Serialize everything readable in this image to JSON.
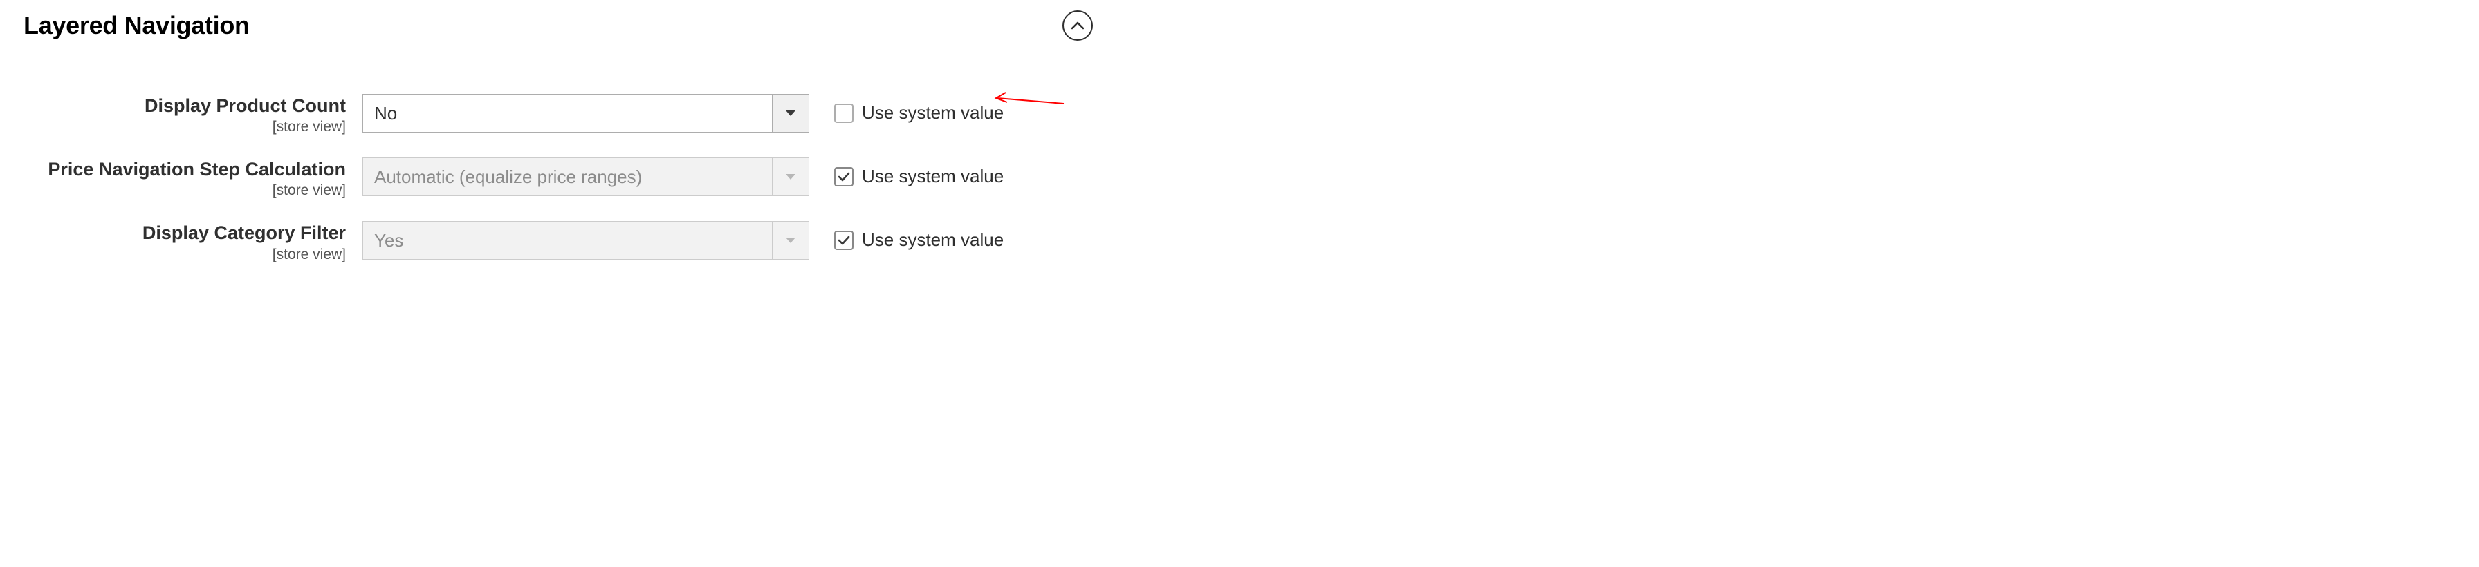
{
  "section": {
    "title": "Layered Navigation"
  },
  "fields": [
    {
      "label": "Display Product Count",
      "scope": "[store view]",
      "value": "No",
      "use_system": false,
      "sys_label": "Use system value",
      "disabled": false
    },
    {
      "label": "Price Navigation Step Calculation",
      "scope": "[store view]",
      "value": "Automatic (equalize price ranges)",
      "use_system": true,
      "sys_label": "Use system value",
      "disabled": true
    },
    {
      "label": "Display Category Filter",
      "scope": "[store view]",
      "value": "Yes",
      "use_system": true,
      "sys_label": "Use system value",
      "disabled": true
    }
  ]
}
